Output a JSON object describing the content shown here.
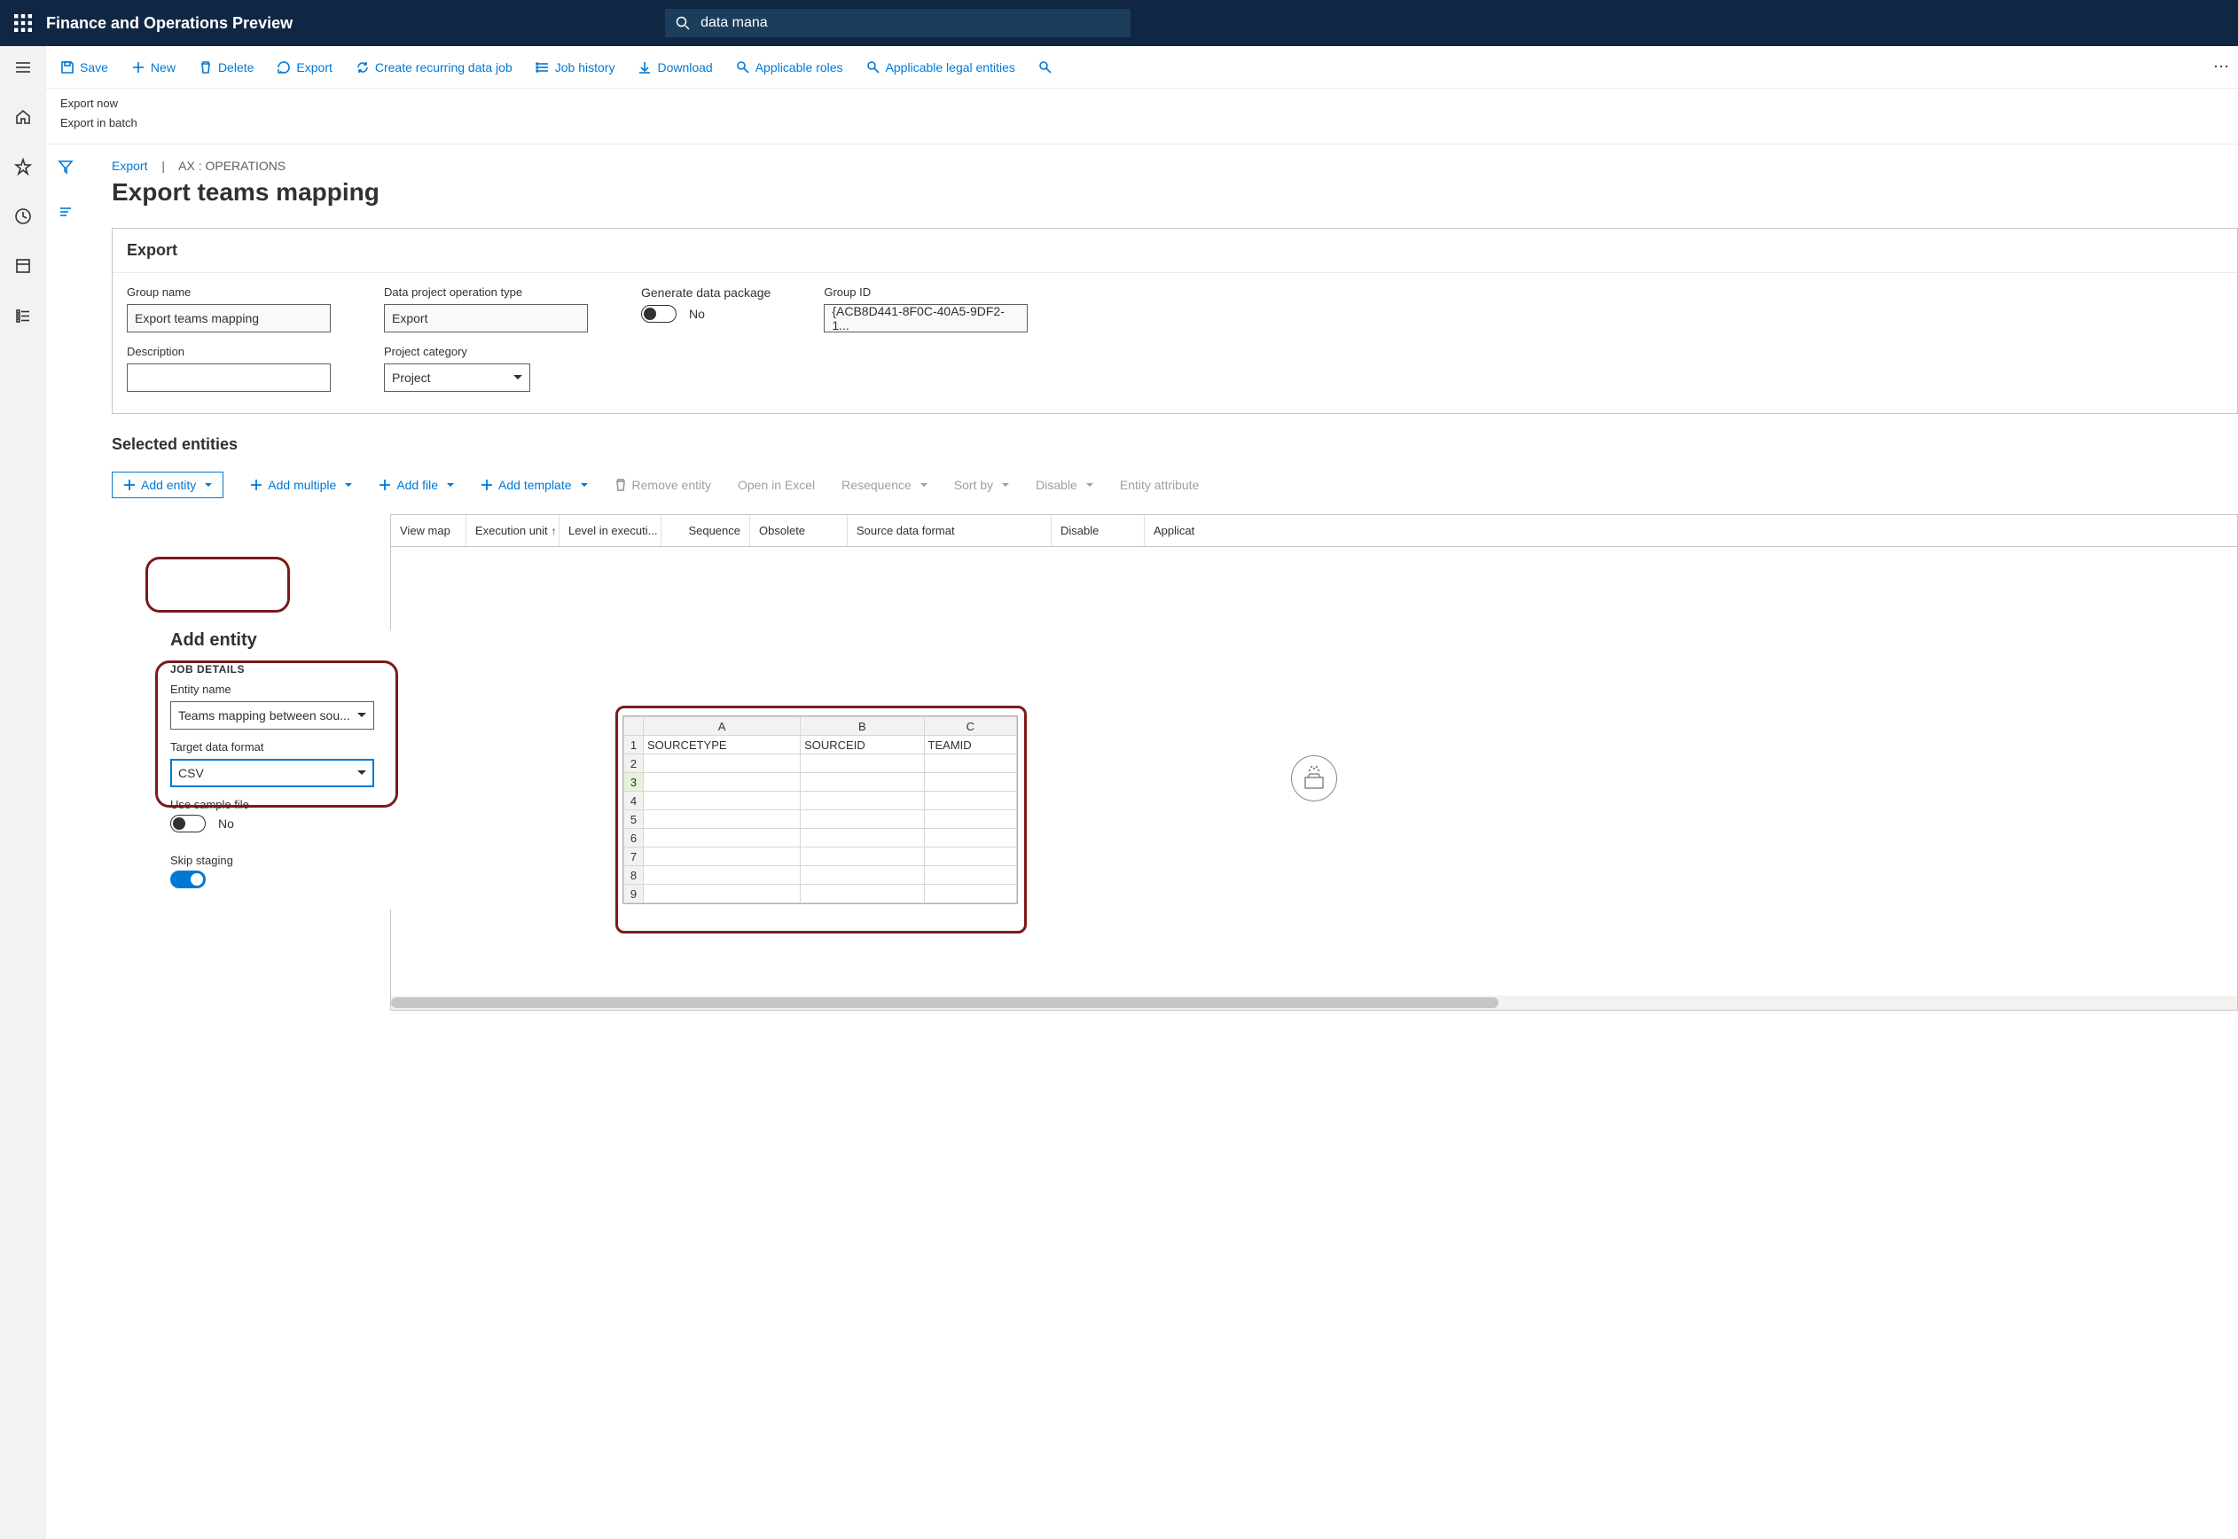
{
  "header": {
    "app_title": "Finance and Operations Preview",
    "search_value": "data mana"
  },
  "commands": {
    "save": "Save",
    "new": "New",
    "delete": "Delete",
    "export": "Export",
    "recurring": "Create recurring data job",
    "job_history": "Job history",
    "download": "Download",
    "applicable_roles": "Applicable roles",
    "applicable_legal": "Applicable legal entities"
  },
  "sub_actions": {
    "export_now": "Export now",
    "export_batch": "Export in batch"
  },
  "breadcrumb": {
    "root": "Export",
    "path": "AX : OPERATIONS"
  },
  "page": {
    "title": "Export teams mapping"
  },
  "export_card": {
    "header": "Export",
    "group_name_label": "Group name",
    "group_name": "Export teams mapping",
    "op_type_label": "Data project operation type",
    "op_type": "Export",
    "desc_label": "Description",
    "desc": "",
    "proj_cat_label": "Project category",
    "proj_cat": "Project",
    "gen_pkg_label": "Generate data package",
    "gen_pkg_value": "No",
    "group_id_label": "Group ID",
    "group_id": "{ACB8D441-8F0C-40A5-9DF2-1..."
  },
  "entities": {
    "section_title": "Selected entities",
    "add_entity": "Add entity",
    "add_multiple": "Add multiple",
    "add_file": "Add file",
    "add_template": "Add template",
    "remove_entity": "Remove entity",
    "open_excel": "Open in Excel",
    "resequence": "Resequence",
    "sort_by": "Sort by",
    "disable": "Disable",
    "entity_attr": "Entity attribute"
  },
  "grid": {
    "cols": {
      "view_map": "View map",
      "exec_unit": "Execution unit",
      "level": "Level in executi...",
      "sequence": "Sequence",
      "obsolete": "Obsolete",
      "src_fmt": "Source data format",
      "disable": "Disable",
      "applicat": "Applicat"
    }
  },
  "add_panel": {
    "title": "Add entity",
    "job_details": "JOB DETAILS",
    "entity_name_label": "Entity name",
    "entity_name": "Teams mapping between sou...",
    "target_fmt_label": "Target data format",
    "target_fmt": "CSV",
    "use_sample_label": "Use sample file",
    "use_sample_value": "No",
    "skip_staging_label": "Skip staging"
  },
  "sheet": {
    "cols": {
      "a": "A",
      "b": "B",
      "c": "C"
    },
    "h1": "SOURCETYPE",
    "h2": "SOURCEID",
    "h3": "TEAMID"
  }
}
